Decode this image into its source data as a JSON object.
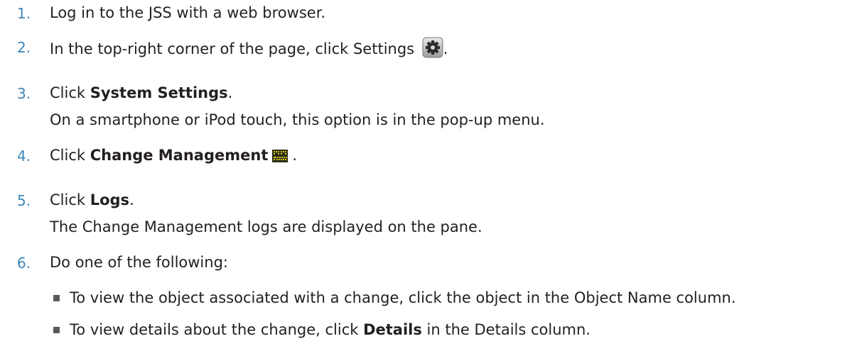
{
  "steps": [
    {
      "num": "1.",
      "text": "Log in to the JSS with a web browser."
    },
    {
      "num": "2.",
      "text_before": "In the top-right corner of the page, click Settings",
      "text_after": "."
    },
    {
      "num": "3.",
      "text_before": "Click ",
      "bold": "System Settings",
      "text_after": ".",
      "note": "On a smartphone or iPod touch, this option is in the pop-up menu."
    },
    {
      "num": "4.",
      "text_before": "Click ",
      "bold": "Change Management",
      "text_after": "."
    },
    {
      "num": "5.",
      "text_before": "Click ",
      "bold": "Logs",
      "text_after": ".",
      "note": "The Change Management logs are displayed on the pane."
    },
    {
      "num": "6.",
      "text": "Do one of the following:"
    }
  ],
  "bullets": [
    {
      "text": "To view the object associated with a change, click the object in the Object Name column."
    },
    {
      "text_before": "To view details about the change, click ",
      "bold": "Details",
      "text_after": " in the Details column."
    }
  ],
  "icons": {
    "settings": "gear-icon",
    "change_management": "change-management-icon"
  },
  "colors": {
    "step_number": "#3d85b8",
    "text": "#231f20"
  }
}
